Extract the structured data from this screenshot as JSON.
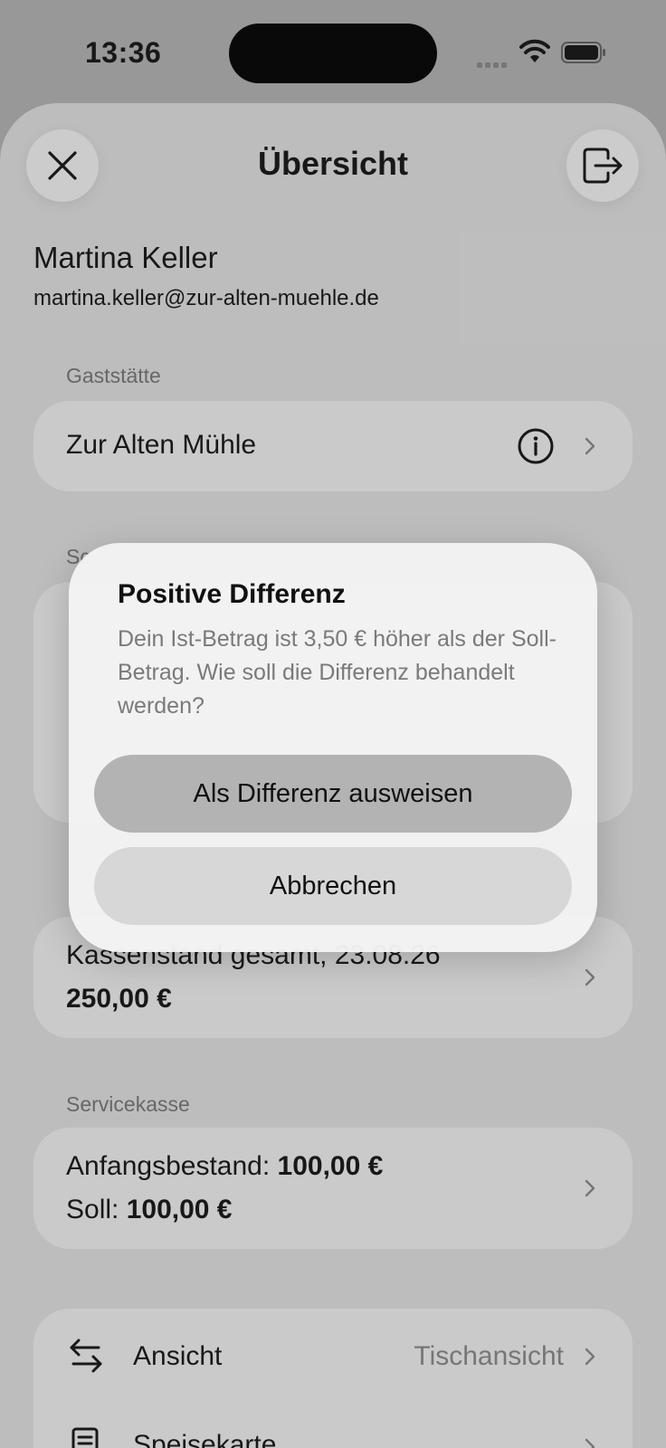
{
  "status_bar": {
    "time": "13:36"
  },
  "header": {
    "title": "Übersicht"
  },
  "user": {
    "name": "Martina Keller",
    "email": "martina.keller@zur-alten-muehle.de"
  },
  "sections": {
    "gaststaette": {
      "label": "Gaststätte",
      "value": "Zur Alten Mühle"
    },
    "partial_label": "Sc",
    "kassenstand": {
      "label": "Kassenstand gesamt, 23.08.26",
      "value": "250,00 €"
    },
    "servicekasse": {
      "label": "Servicekasse",
      "anfangsbestand_label": "Anfangsbestand:",
      "anfangsbestand_value": "100,00 €",
      "soll_label": "Soll:",
      "soll_value": "100,00 €"
    }
  },
  "settings": {
    "ansicht_label": "Ansicht",
    "ansicht_value": "Tischansicht",
    "speisekarte_label": "Speisekarte"
  },
  "dialog": {
    "title": "Positive Differenz",
    "message": "Dein Ist-Betrag ist 3,50 € höher als der Soll-Betrag. Wie soll die Differenz behandelt werden?",
    "primary_button": "Als Differenz ausweisen",
    "cancel_button": "Abbrechen"
  },
  "icons": [
    "close-icon",
    "logout-icon",
    "info-icon",
    "chevron-right-icon",
    "swap-arrows-icon",
    "menu-card-icon",
    "wifi-icon",
    "battery-icon",
    "cellular-signal-icon"
  ]
}
